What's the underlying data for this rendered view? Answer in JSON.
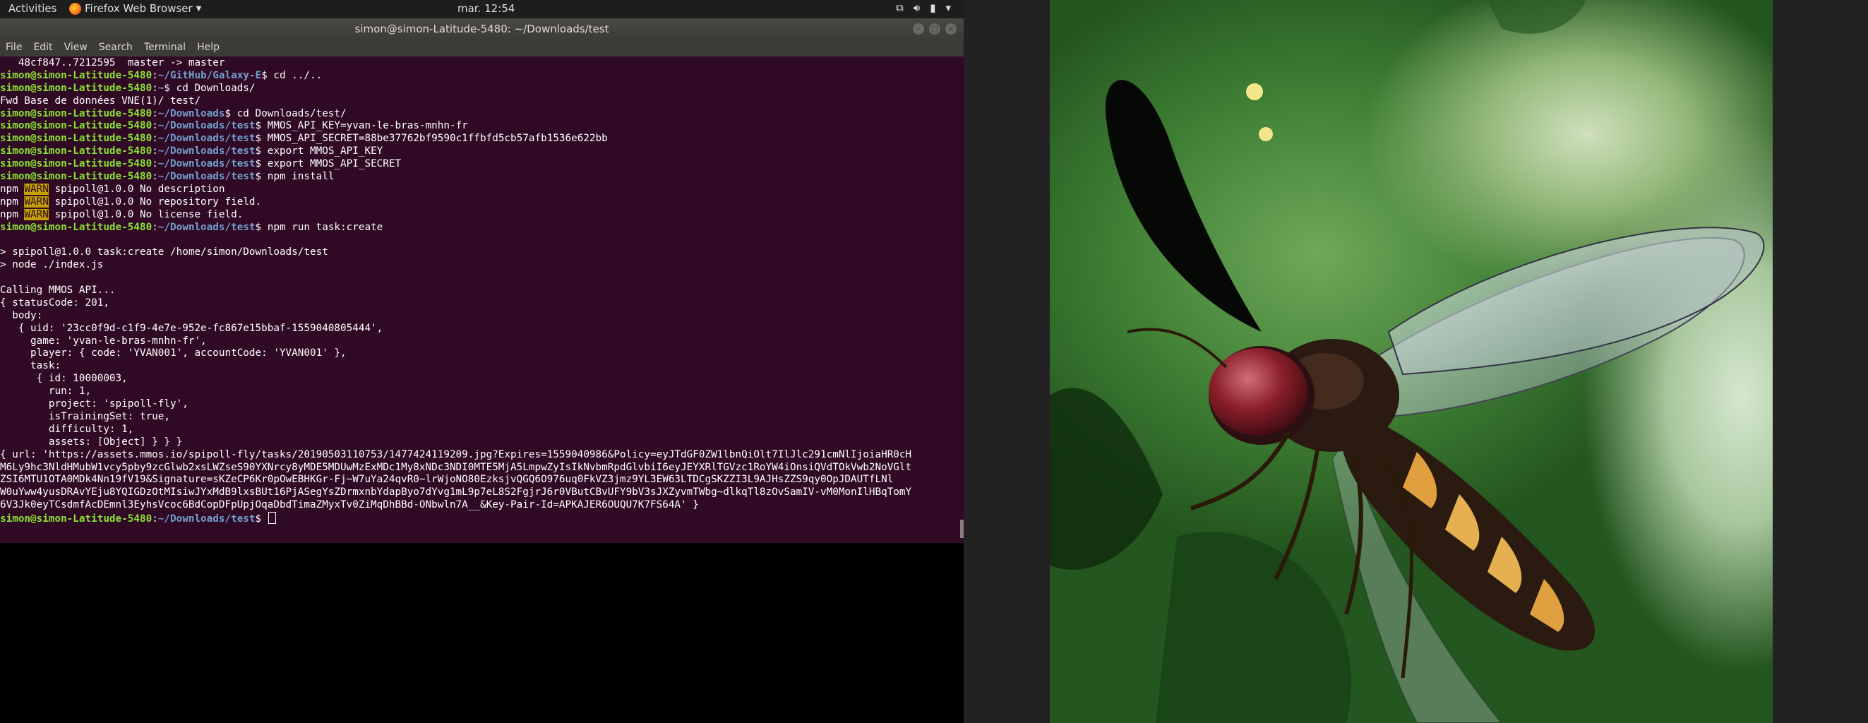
{
  "top_panel": {
    "activities": "Activities",
    "app_menu": "Firefox Web Browser",
    "clock": "mar. 12:54",
    "tray_icons": [
      "network-icon",
      "volume-icon",
      "battery-icon",
      "system-menu-icon"
    ]
  },
  "terminal": {
    "title": "simon@simon-Latitude-5480: ~/Downloads/test",
    "menu": [
      "File",
      "Edit",
      "View",
      "Search",
      "Terminal",
      "Help"
    ],
    "prompt_user": "simon@simon-Latitude-5480",
    "lines": [
      {
        "t": "o",
        "text": "   48cf847..7212595  master -> master"
      },
      {
        "t": "p",
        "path": "~/GitHub/Galaxy-E",
        "cmd": "$ cd ../.."
      },
      {
        "t": "p",
        "path": "~",
        "cmd": "$ cd Downloads/"
      },
      {
        "t": "o",
        "text": "Fwd Base de données VNE(1)/ test/"
      },
      {
        "t": "p",
        "path": "~/Downloads",
        "cmd": "$ cd Downloads/test/"
      },
      {
        "t": "p",
        "path": "~/Downloads/test",
        "cmd": "$ MMOS_API_KEY=yvan-le-bras-mnhn-fr"
      },
      {
        "t": "p",
        "path": "~/Downloads/test",
        "cmd": "$ MMOS_API_SECRET=88be37762bf9590c1ffbfd5cb57afb1536e622bb"
      },
      {
        "t": "p",
        "path": "~/Downloads/test",
        "cmd": "$ export MMOS_API_KEY"
      },
      {
        "t": "p",
        "path": "~/Downloads/test",
        "cmd": "$ export MMOS_API_SECRET"
      },
      {
        "t": "p",
        "path": "~/Downloads/test",
        "cmd": "$ npm install"
      },
      {
        "t": "w",
        "pre": "npm ",
        "badge": "WARN",
        "post": " spipoll@1.0.0 No description"
      },
      {
        "t": "w",
        "pre": "npm ",
        "badge": "WARN",
        "post": " spipoll@1.0.0 No repository field."
      },
      {
        "t": "w",
        "pre": "npm ",
        "badge": "WARN",
        "post": " spipoll@1.0.0 No license field."
      },
      {
        "t": "p",
        "path": "~/Downloads/test",
        "cmd": "$ npm run task:create"
      },
      {
        "t": "o",
        "text": ""
      },
      {
        "t": "o",
        "text": "> spipoll@1.0.0 task:create /home/simon/Downloads/test"
      },
      {
        "t": "o",
        "text": "> node ./index.js"
      },
      {
        "t": "o",
        "text": ""
      },
      {
        "t": "o",
        "text": "Calling MMOS API..."
      },
      {
        "t": "o",
        "text": "{ statusCode: 201,"
      },
      {
        "t": "o",
        "text": "  body:"
      },
      {
        "t": "o",
        "text": "   { uid: '23cc0f9d-c1f9-4e7e-952e-fc867e15bbaf-1559040805444',"
      },
      {
        "t": "o",
        "text": "     game: 'yvan-le-bras-mnhn-fr',"
      },
      {
        "t": "o",
        "text": "     player: { code: 'YVAN001', accountCode: 'YVAN001' },"
      },
      {
        "t": "o",
        "text": "     task:"
      },
      {
        "t": "o",
        "text": "      { id: 10000003,"
      },
      {
        "t": "o",
        "text": "        run: 1,"
      },
      {
        "t": "o",
        "text": "        project: 'spipoll-fly',"
      },
      {
        "t": "o",
        "text": "        isTrainingSet: true,"
      },
      {
        "t": "o",
        "text": "        difficulty: 1,"
      },
      {
        "t": "o",
        "text": "        assets: [Object] } } }"
      },
      {
        "t": "o",
        "text": "{ url: 'https://assets.mmos.io/spipoll-fly/tasks/20190503110753/1477424119209.jpg?Expires=1559040986&Policy=eyJTdGF0ZW1lbnQiOlt7IlJlc291cmNlIjoiaHR0cH"
      },
      {
        "t": "o",
        "text": "M6Ly9hc3NldHMubW1vcy5pby9zcGlwb2xsLWZseS90YXNrcy8yMDE5MDUwMzExMDc1My8xNDc3NDI0MTE5MjA5LmpwZyIsIkNvbmRpdGlvbiI6eyJEYXRlTGVzc1RoYW4iOnsiQVdTOkVwb2NoVGlt"
      },
      {
        "t": "o",
        "text": "ZSI6MTU1OTA0MDk4Nn19fV19&Signature=sKZeCP6Kr0pOwEBHKGr-Fj~W7uYa24qvR0~lrWjoNO80EzksjvQGQ6O976uq0FkVZ3jmz9YL3EW63LTDCgSKZZI3L9AJHsZZS9qy0OpJDAUTfLNl"
      },
      {
        "t": "o",
        "text": "W0uYww4yusDRAvYEju8YQIGDzOtMIsiwJYxMdB9lxsBUt16PjASegYsZDrmxnbYdapByo7dYvg1mL9p7eL8S2FgjrJ6r0VButCBvUFY9bV3sJXZyvmTWbg~dlkqTl8zOvSamIV-vM0MonIlHBqTomY"
      },
      {
        "t": "o",
        "text": "6V3Jk0eyTCsdmfAcDEmnl3EyhsVcoc6BdCopDFpUpjOqaDbdTimaZMyxTv0ZiMqDhBBd-ONbwln7A__&Key-Pair-Id=APKAJER6OUQU7K7FS64A' }"
      },
      {
        "t": "c",
        "path": "~/Downloads/test",
        "cmd": "$ "
      }
    ]
  },
  "viewer": {
    "image_subject": "hoverfly-on-leaf"
  }
}
